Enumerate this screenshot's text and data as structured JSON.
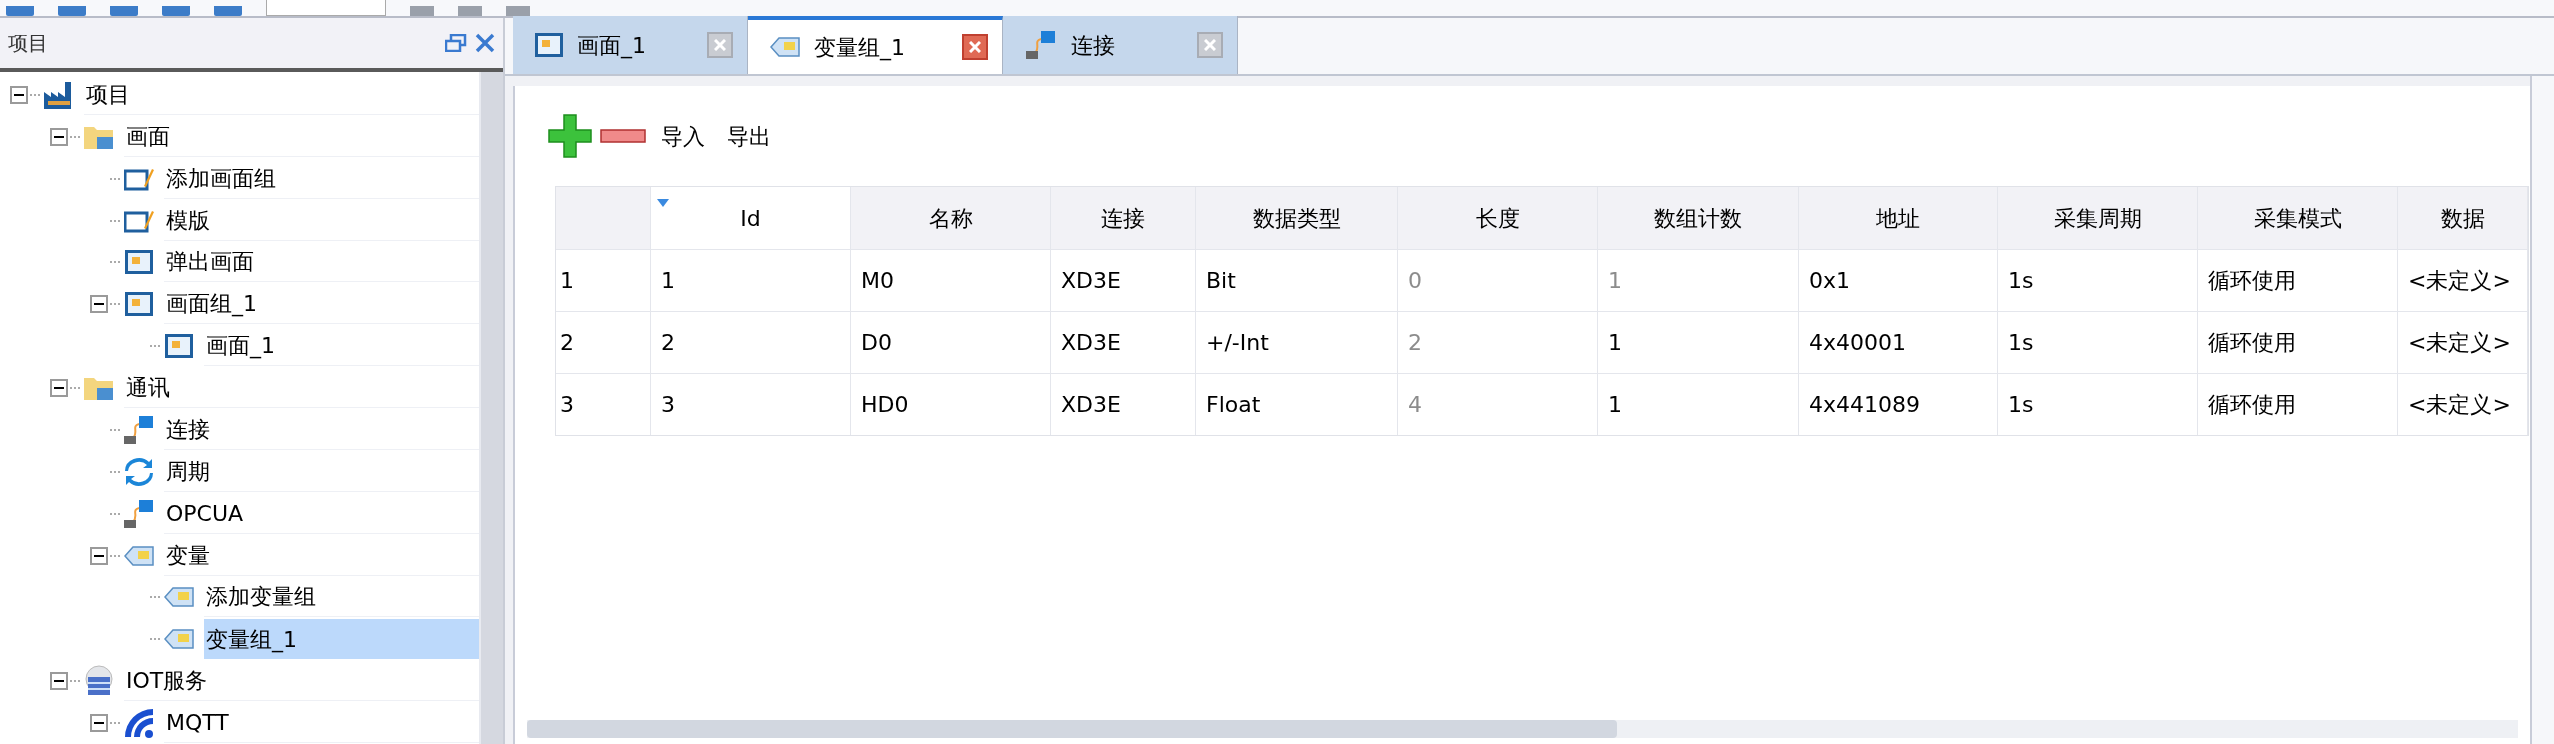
{
  "panel": {
    "title": "项目"
  },
  "tree": [
    {
      "label": "项目",
      "kind": "project",
      "expanded": true,
      "selected": false,
      "children": [
        {
          "label": "画面",
          "kind": "folder",
          "expanded": true,
          "selected": false,
          "children": [
            {
              "label": "添加画面组",
              "kind": "template",
              "selected": false
            },
            {
              "label": "模版",
              "kind": "template",
              "selected": false
            },
            {
              "label": "弹出画面",
              "kind": "screen",
              "selected": false
            },
            {
              "label": "画面组_1",
              "kind": "screen",
              "expanded": true,
              "selected": false,
              "children": [
                {
                  "label": "画面_1",
                  "kind": "screen",
                  "selected": false
                }
              ]
            }
          ]
        },
        {
          "label": "通讯",
          "kind": "folder",
          "expanded": true,
          "selected": false,
          "children": [
            {
              "label": "连接",
              "kind": "connection",
              "selected": false
            },
            {
              "label": "周期",
              "kind": "cycle",
              "selected": false
            },
            {
              "label": "OPCUA",
              "kind": "connection",
              "selected": false
            },
            {
              "label": "变量",
              "kind": "variable",
              "expanded": true,
              "selected": false,
              "children": [
                {
                  "label": "添加变量组",
                  "kind": "variable",
                  "selected": false
                },
                {
                  "label": "变量组_1",
                  "kind": "variable",
                  "selected": true
                }
              ]
            }
          ]
        },
        {
          "label": "IOT服务",
          "kind": "service",
          "expanded": true,
          "selected": false,
          "children": [
            {
              "label": "MQTT",
              "kind": "signal",
              "expanded": true,
              "selected": false
            }
          ]
        }
      ]
    }
  ],
  "tabs": [
    {
      "label": "画面_1",
      "kind": "screen",
      "selected": false
    },
    {
      "label": "变量组_1",
      "kind": "variable",
      "selected": true
    },
    {
      "label": "连接",
      "kind": "connection",
      "selected": false
    }
  ],
  "actions": [
    {
      "kind": "add"
    },
    {
      "kind": "remove"
    },
    {
      "kind": "text",
      "label": "导入"
    },
    {
      "kind": "text",
      "label": "导出"
    }
  ],
  "table": {
    "columns": [
      {
        "sorted": false
      },
      {
        "label": "Id",
        "sorted": true
      },
      {
        "label": "名称",
        "sorted": false
      },
      {
        "label": "连接",
        "sorted": false
      },
      {
        "label": "数据类型",
        "sorted": false
      },
      {
        "label": "长度",
        "sorted": false
      },
      {
        "label": "数组计数",
        "sorted": false
      },
      {
        "label": "地址",
        "sorted": false
      },
      {
        "label": "采集周期",
        "sorted": false
      },
      {
        "label": "采集模式",
        "sorted": false
      },
      {
        "label": "数据",
        "sorted": false
      }
    ],
    "rows": [
      {
        "cells": [
          {
            "text": "1",
            "greyed": false
          },
          {
            "text": "1",
            "greyed": false
          },
          {
            "text": "M0",
            "greyed": false
          },
          {
            "text": "XD3E",
            "greyed": false
          },
          {
            "text": "Bit",
            "greyed": false
          },
          {
            "text": "0",
            "greyed": true
          },
          {
            "text": "1",
            "greyed": true
          },
          {
            "text": "0x1",
            "greyed": false
          },
          {
            "text": "1s",
            "greyed": false
          },
          {
            "text": "循环使用",
            "greyed": false
          },
          {
            "text": "<未定义>",
            "greyed": false
          }
        ]
      },
      {
        "cells": [
          {
            "text": "2",
            "greyed": false
          },
          {
            "text": "2",
            "greyed": false
          },
          {
            "text": "D0",
            "greyed": false
          },
          {
            "text": "XD3E",
            "greyed": false
          },
          {
            "text": "+/-Int",
            "greyed": false
          },
          {
            "text": "2",
            "greyed": true
          },
          {
            "text": "1",
            "greyed": false
          },
          {
            "text": "4x40001",
            "greyed": false
          },
          {
            "text": "1s",
            "greyed": false
          },
          {
            "text": "循环使用",
            "greyed": false
          },
          {
            "text": "<未定义>",
            "greyed": false
          }
        ]
      },
      {
        "cells": [
          {
            "text": "3",
            "greyed": false
          },
          {
            "text": "3",
            "greyed": false
          },
          {
            "text": "HD0",
            "greyed": false
          },
          {
            "text": "XD3E",
            "greyed": false
          },
          {
            "text": "Float",
            "greyed": false
          },
          {
            "text": "4",
            "greyed": true
          },
          {
            "text": "1",
            "greyed": false
          },
          {
            "text": "4x441089",
            "greyed": false
          },
          {
            "text": "1s",
            "greyed": false
          },
          {
            "text": "循环使用",
            "greyed": false
          },
          {
            "text": "<未定义>",
            "greyed": false
          }
        ]
      }
    ]
  }
}
